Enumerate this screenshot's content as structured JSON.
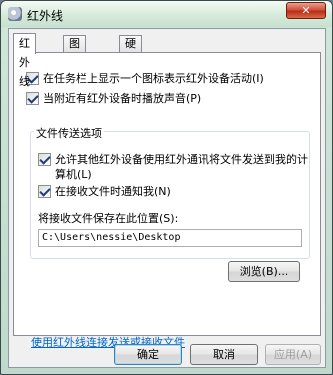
{
  "window": {
    "title": "红外线",
    "close_symbol": "✕"
  },
  "tabs": [
    {
      "label": "红外线"
    },
    {
      "label": "图像传送"
    },
    {
      "label": "硬件"
    }
  ],
  "options": {
    "taskbar_icon": {
      "label": "在任务栏上显示一个图标表示红外设备活动(I)",
      "checked": true
    },
    "play_sound": {
      "label": "当附近有红外设备时播放声音(P)",
      "checked": true
    }
  },
  "transfer_group": {
    "title": "文件传送选项",
    "allow_send": {
      "label_line1": "允许其他红外设备使用红外通讯将文件发送到我的计",
      "label_line2": "算机(L)",
      "checked": true
    },
    "notify_receive": {
      "label": "在接收文件时通知我(N)",
      "checked": true
    },
    "save_location_label": "将接收文件保存在此位置(S):",
    "save_location_value": "C:\\Users\\nessie\\Desktop",
    "browse_label": "浏览(B)..."
  },
  "link_text": "使用红外线连接发送或接收文件",
  "buttons": {
    "ok": "确定",
    "cancel": "取消",
    "apply": "应用(A)"
  },
  "colors": {
    "link": "#0066cc",
    "checkmark": "#1f3d7a"
  }
}
